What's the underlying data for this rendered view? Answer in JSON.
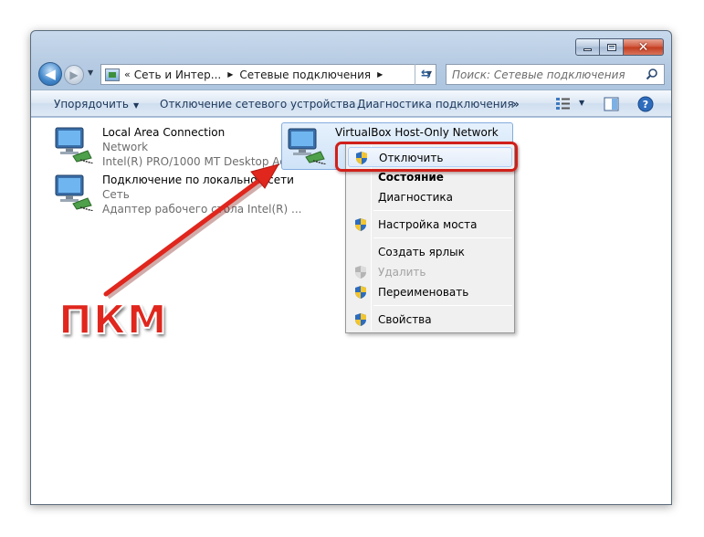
{
  "window": {
    "caption_buttons": {
      "minimize": "minimize",
      "maximize": "maximize",
      "close": "✕"
    }
  },
  "navigation": {
    "address_chevron": "«",
    "breadcrumbs": [
      "Сеть и Интер...",
      "Сетевые подключения"
    ],
    "search_placeholder": "Поиск: Сетевые подключения"
  },
  "toolbar": {
    "organize": "Упорядочить",
    "disable_device": "Отключение сетевого устройства",
    "diagnose": "Диагностика подключения",
    "more": "»"
  },
  "connections": [
    {
      "name": "Local Area Connection",
      "network": "Network",
      "adapter": "Intel(R) PRO/1000 MT Desktop Ad..."
    },
    {
      "name": "Подключение по локальной сети",
      "network": "Сеть",
      "adapter": "Адаптер рабочего стола Intel(R) ..."
    },
    {
      "name": "VirtualBox Host-Only Network",
      "network": "",
      "adapter": ""
    }
  ],
  "context_menu": {
    "items": [
      {
        "label": "Отключить",
        "shield": true,
        "bold": false,
        "disabled": false
      },
      {
        "label": "Состояние",
        "shield": false,
        "bold": true,
        "disabled": false
      },
      {
        "label": "Диагностика",
        "shield": false,
        "bold": false,
        "disabled": false
      },
      {
        "label": "Настройка моста",
        "shield": true,
        "bold": false,
        "disabled": false
      },
      {
        "label": "Создать ярлык",
        "shield": false,
        "bold": false,
        "disabled": false
      },
      {
        "label": "Удалить",
        "shield": true,
        "bold": false,
        "disabled": true
      },
      {
        "label": "Переименовать",
        "shield": true,
        "bold": false,
        "disabled": false
      },
      {
        "label": "Свойства",
        "shield": true,
        "bold": false,
        "disabled": false
      }
    ]
  },
  "annotation": {
    "label": "ПКМ",
    "color": "#e0261d"
  }
}
